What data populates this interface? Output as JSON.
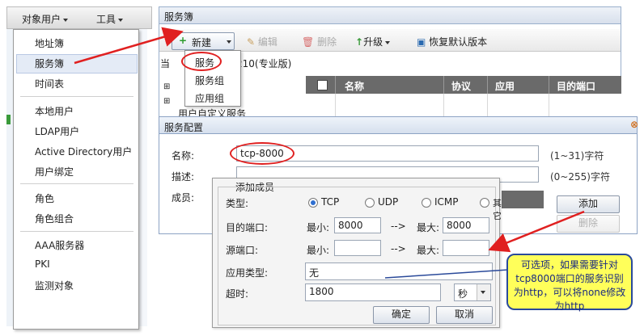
{
  "topbar": {
    "objects_menu": "对象用户",
    "tools_menu": "工具"
  },
  "objects_menu_items": [
    {
      "label": "地址簿"
    },
    {
      "label": "服务簿"
    },
    {
      "label": "时间表"
    },
    {
      "label": "本地用户"
    },
    {
      "label": "LDAP用户"
    },
    {
      "label": "Active Directory用户"
    },
    {
      "label": "用户绑定"
    },
    {
      "label": "角色"
    },
    {
      "label": "角色组合"
    },
    {
      "label": "AAA服务器"
    },
    {
      "label": "PKI"
    },
    {
      "label": "监测对象"
    }
  ],
  "service_book": {
    "title": "服务簿",
    "toolbar": {
      "new": "新建",
      "edit": "编辑",
      "delete": "删除",
      "upgrade": "升级",
      "restore": "恢复默认版本"
    },
    "new_menu": [
      "服务",
      "服务组",
      "应用组"
    ],
    "breadcrumb_prefix": "当",
    "breadcrumb_suffix": "210(专业版)",
    "tree_item": "用户自定义服务",
    "grid_headers": [
      "名称",
      "协议",
      "应用",
      "目的端口"
    ]
  },
  "service_config": {
    "title": "服务配置",
    "name_label": "名称:",
    "name_value": "tcp-8000",
    "name_hint": "(1~31)字符",
    "desc_label": "描述:",
    "desc_value": "",
    "desc_hint": "(0~255)字符",
    "member_label": "成员:",
    "add_button": "添加",
    "delete_button": "删除"
  },
  "add_member": {
    "title": "添加成员",
    "type_label": "类型:",
    "types": [
      "TCP",
      "UDP",
      "ICMP",
      "其它"
    ],
    "selected_type": "TCP",
    "dest_port_label": "目的端口:",
    "src_port_label": "源端口:",
    "min_label": "最小:",
    "max_label": "最大:",
    "range_arrow": "-->",
    "dest_min": "8000",
    "dest_max": "8000",
    "src_min": "",
    "src_max": "",
    "app_type_label": "应用类型:",
    "app_type_value": "无",
    "timeout_label": "超时:",
    "timeout_value": "1800",
    "timeout_unit": "秒",
    "ok_button": "确定",
    "cancel_button": "取消"
  },
  "callout_text": "可选项，如果需要针对tcp8000端口的服务识别为http，可以将none修改为http",
  "colors": {
    "annotation_red": "#e02020",
    "callout_bg": "#ffff5a",
    "grid_header": "#6a6a6a"
  }
}
